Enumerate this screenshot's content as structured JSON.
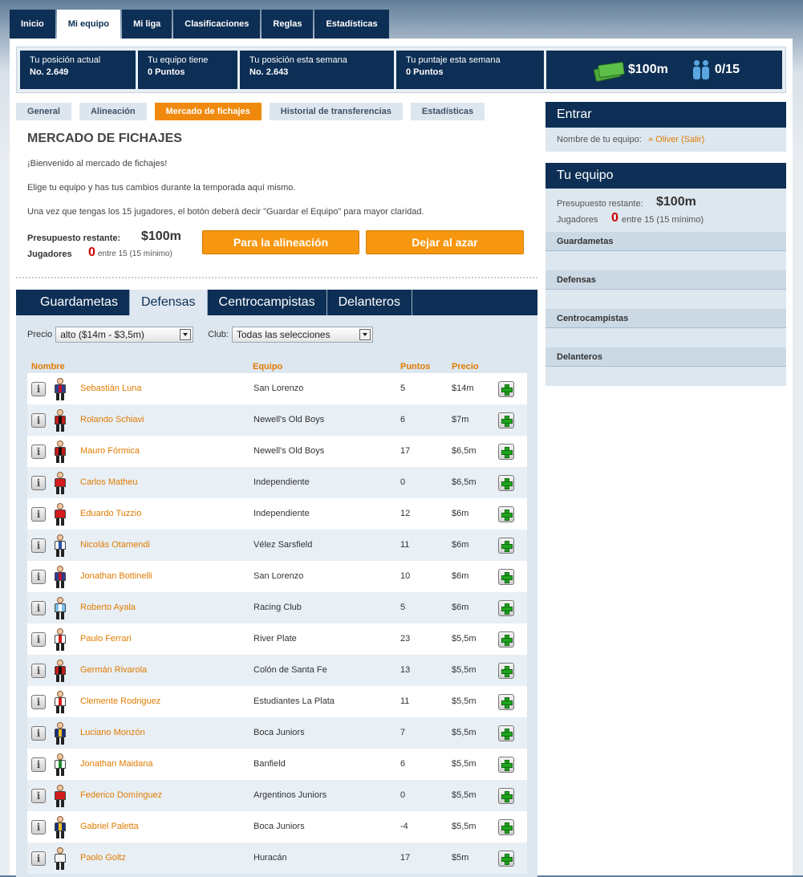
{
  "nav": {
    "tabs": [
      {
        "label": "Inicio",
        "active": false
      },
      {
        "label": "Mi equipo",
        "active": true
      },
      {
        "label": "Mi liga",
        "active": false
      },
      {
        "label": "Clasificaciones",
        "active": false
      },
      {
        "label": "Reglas",
        "active": false
      },
      {
        "label": "Estadísticas",
        "active": false
      }
    ]
  },
  "stats": {
    "position_label": "Tu posición actual",
    "position_value": "No. 2.649",
    "team_label": "Tu equipo tiene",
    "team_value": "0 Puntos",
    "week_pos_label": "Tu posición esta semana",
    "week_pos_value": "No. 2.643",
    "week_pts_label": "Tu puntaje esta semana",
    "week_pts_value": "0 Puntos",
    "money": "$100m",
    "players": "0/15"
  },
  "subtabs": [
    {
      "label": "General",
      "active": false
    },
    {
      "label": "Alineación",
      "active": false
    },
    {
      "label": "Mercado de fichajes",
      "active": true
    },
    {
      "label": "Historial de transferencias",
      "active": false
    },
    {
      "label": "Estadísticas",
      "active": false
    }
  ],
  "market": {
    "title": "MERCADO DE FICHAJES",
    "intro1": "¡Bienvenido al mercado de fichajes!",
    "intro2": "Elige tu equipo y has tus cambios durante la temporada aquí mismo.",
    "intro3": "Una vez que tengas los 15 jugadores, el botón deberá decir \"Guardar el Equipo\" para mayor claridad.",
    "budget_label": "Presupuesto restante:",
    "budget_value": "$100m",
    "players_label": "Jugadores",
    "players_count": "0",
    "players_note": "entre 15 (15 mínimo)",
    "btn_lineup": "Para la alineación",
    "btn_random": "Dejar al azar"
  },
  "positions": [
    {
      "label": "Guardametas",
      "active": false
    },
    {
      "label": "Defensas",
      "active": true
    },
    {
      "label": "Centrocampistas",
      "active": false
    },
    {
      "label": "Delanteros",
      "active": false
    }
  ],
  "filters": {
    "price_label": "Precio",
    "price_value": "alto ($14m - $3,5m)",
    "club_label": "Club:",
    "club_value": "Todas las selecciones"
  },
  "table": {
    "headers": {
      "name": "Nombre",
      "team": "Equipo",
      "points": "Puntos",
      "price": "Precio"
    },
    "rows": [
      {
        "name": "Sebastián Luna",
        "team": "San Lorenzo",
        "points": "5",
        "price": "$14m",
        "shirt": "#2b3c8e",
        "stripe": "#c0142a"
      },
      {
        "name": "Rolando Schiavi",
        "team": "Newell's Old Boys",
        "points": "6",
        "price": "$7m",
        "shirt": "#c21a1a",
        "stripe": "#111111"
      },
      {
        "name": "Mauro Fórmica",
        "team": "Newell's Old Boys",
        "points": "17",
        "price": "$6,5m",
        "shirt": "#c21a1a",
        "stripe": "#111111"
      },
      {
        "name": "Carlos Matheu",
        "team": "Independiente",
        "points": "0",
        "price": "$6,5m",
        "shirt": "#d41c1c",
        "stripe": "#d41c1c"
      },
      {
        "name": "Eduardo Tuzzio",
        "team": "Independiente",
        "points": "12",
        "price": "$6m",
        "shirt": "#d41c1c",
        "stripe": "#d41c1c"
      },
      {
        "name": "Nicolás Otamendi",
        "team": "Vélez Sarsfield",
        "points": "11",
        "price": "$6m",
        "shirt": "#f4f4f4",
        "stripe": "#2a52a8"
      },
      {
        "name": "Jonathan Bottinelli",
        "team": "San Lorenzo",
        "points": "10",
        "price": "$6m",
        "shirt": "#2b3c8e",
        "stripe": "#c0142a"
      },
      {
        "name": "Roberto Ayala",
        "team": "Racing Club",
        "points": "5",
        "price": "$6m",
        "shirt": "#7cc0ea",
        "stripe": "#ffffff"
      },
      {
        "name": "Paulo Ferrari",
        "team": "River Plate",
        "points": "23",
        "price": "$5,5m",
        "shirt": "#ffffff",
        "stripe": "#d41c1c"
      },
      {
        "name": "Germán Rivarola",
        "team": "Colón de Santa Fe",
        "points": "13",
        "price": "$5,5m",
        "shirt": "#c21a1a",
        "stripe": "#111111"
      },
      {
        "name": "Clemente Rodriguez",
        "team": "Estudiantes La Plata",
        "points": "11",
        "price": "$5,5m",
        "shirt": "#ffffff",
        "stripe": "#d41c1c"
      },
      {
        "name": "Luciano Monzón",
        "team": "Boca Juniors",
        "points": "7",
        "price": "$5,5m",
        "shirt": "#1a2f7a",
        "stripe": "#f2c21b"
      },
      {
        "name": "Jonathan Maidana",
        "team": "Banfield",
        "points": "6",
        "price": "$5,5m",
        "shirt": "#ffffff",
        "stripe": "#1e8a2e"
      },
      {
        "name": "Federico Domínguez",
        "team": "Argentinos Juniors",
        "points": "0",
        "price": "$5,5m",
        "shirt": "#d41c1c",
        "stripe": "#d41c1c"
      },
      {
        "name": "Gabriel Paletta",
        "team": "Boca Juniors",
        "points": "-4",
        "price": "$5,5m",
        "shirt": "#1a2f7a",
        "stripe": "#f2c21b"
      },
      {
        "name": "Paolo Goltz",
        "team": "Huracán",
        "points": "17",
        "price": "$5m",
        "shirt": "#f4f4f4",
        "stripe": "#f4f4f4"
      }
    ]
  },
  "sidebar": {
    "login_title": "Entrar",
    "team_name_label": "Nombre de tu equipo:",
    "team_name_link": "» Oliver (Salir)",
    "team_title": "Tu equipo",
    "budget_label": "Presupuesto restante:",
    "budget_value": "$100m",
    "players_label": "Jugadores",
    "players_count": "0",
    "players_note": "entre 15 (15 mínimo)",
    "sections": [
      "Guardametas",
      "Defensas",
      "Centrocampistas",
      "Delanteros"
    ]
  }
}
